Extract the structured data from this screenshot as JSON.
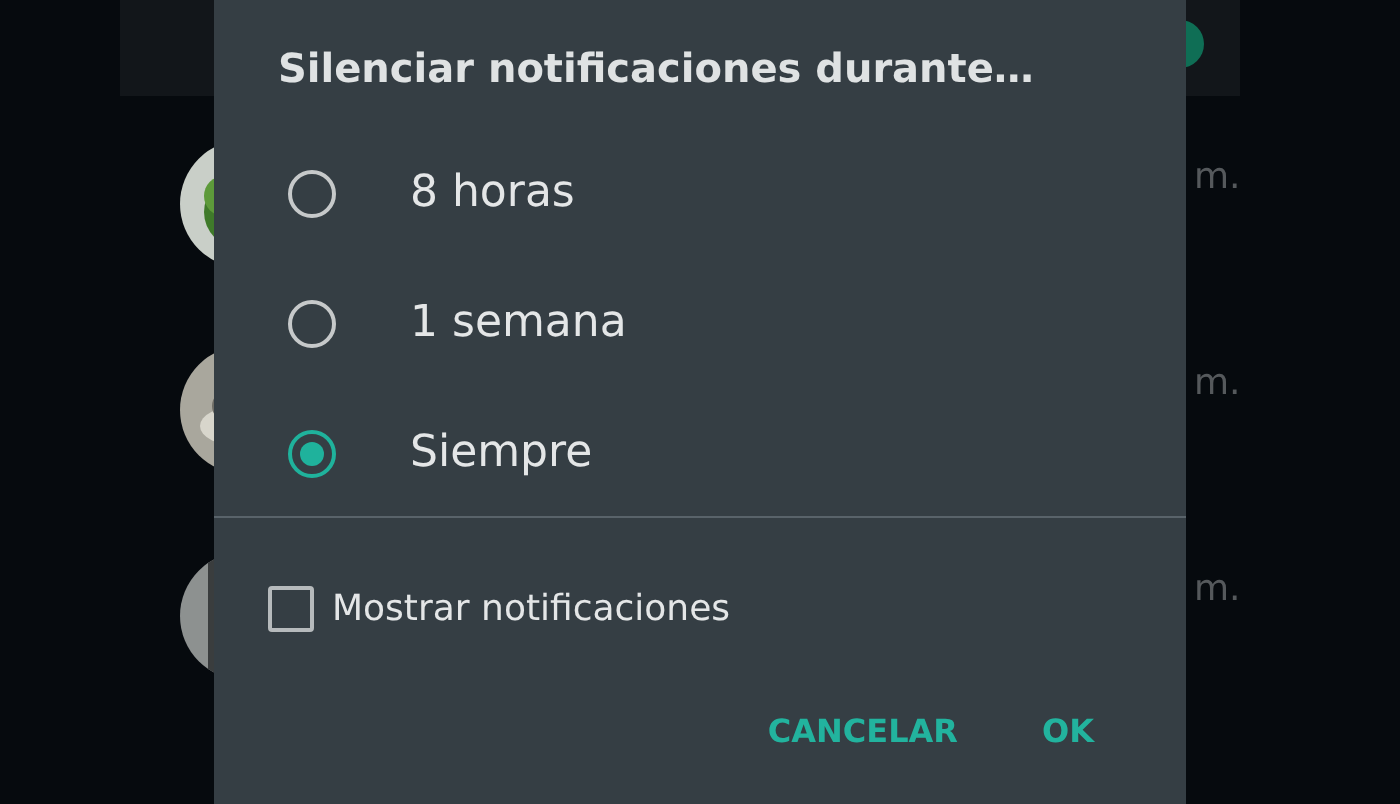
{
  "chat_list": [
    {
      "time": "m."
    },
    {
      "time": "m."
    },
    {
      "time": "m."
    }
  ],
  "dialog": {
    "title": "Silenciar notificaciones durante…",
    "options": [
      {
        "label": "8 horas",
        "selected": false
      },
      {
        "label": "1 semana",
        "selected": false
      },
      {
        "label": "Siempre",
        "selected": true
      }
    ],
    "show_notifications": {
      "label": "Mostrar notificaciones",
      "checked": false
    },
    "buttons": [
      "CANCELAR",
      "OK"
    ]
  }
}
